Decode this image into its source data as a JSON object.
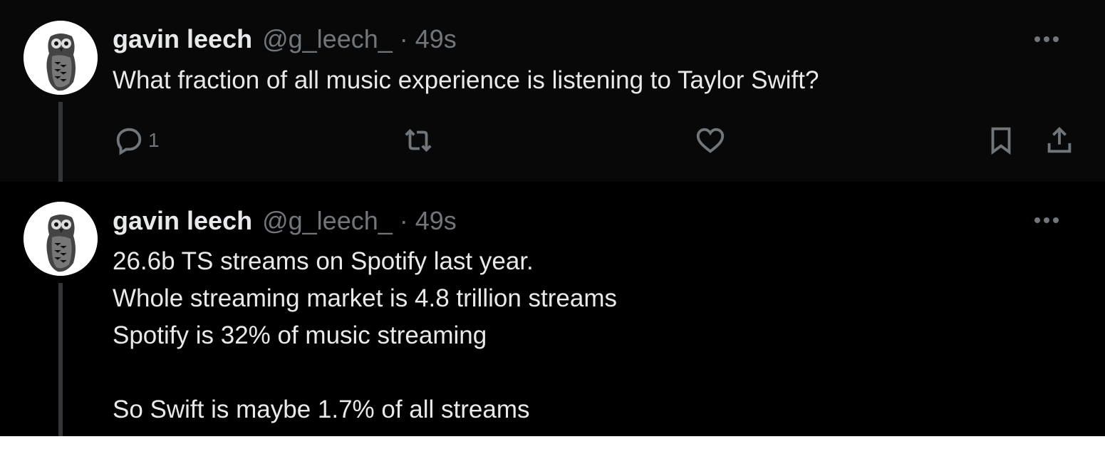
{
  "tweets": [
    {
      "author_name": "gavin leech",
      "handle": "@g_leech_",
      "dot": "·",
      "time": "49s",
      "text": "What fraction of all music experience is listening to Taylor Swift?",
      "actions": {
        "reply_count": "1"
      }
    },
    {
      "author_name": "gavin leech",
      "handle": "@g_leech_",
      "dot": "·",
      "time": "49s",
      "text": "26.6b TS streams on Spotify last year.\nWhole streaming market is 4.8 trillion streams\nSpotify is 32% of music streaming\n\nSo Swift is maybe 1.7% of all streams"
    }
  ],
  "icons": {
    "more": "more-horizontal-icon",
    "reply": "reply-icon",
    "retweet": "retweet-icon",
    "like": "heart-icon",
    "bookmark": "bookmark-icon",
    "share": "share-icon"
  },
  "colors": {
    "background": "#000000",
    "tweet1_background": "#080808",
    "primary_text": "#e7e9ea",
    "secondary_text": "#71767b",
    "thread_line": "#333639"
  }
}
